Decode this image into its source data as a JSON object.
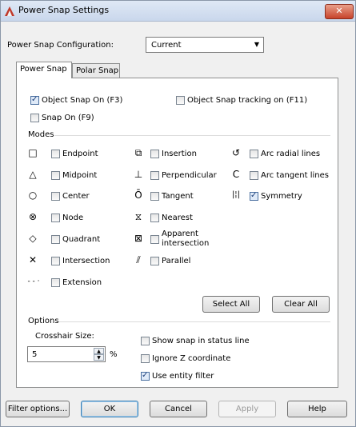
{
  "window": {
    "title": "Power Snap Settings",
    "close_glyph": "✕"
  },
  "config": {
    "label": "Power Snap Configuration:",
    "value": "Current",
    "arrow": "▼"
  },
  "tabs": [
    {
      "label": "Power Snap",
      "active": true
    },
    {
      "label": "Polar Snap",
      "active": false
    }
  ],
  "top_options": {
    "object_snap": {
      "label": "Object Snap On (F3)",
      "checked": true
    },
    "object_snap_tracking": {
      "label": "Object Snap tracking on (F11)",
      "checked": false
    },
    "snap": {
      "label": "Snap On (F9)",
      "checked": false
    }
  },
  "modes": {
    "title": "Modes",
    "items": [
      {
        "label": "Endpoint",
        "icon": "endpoint-icon",
        "glyph": "□",
        "checked": false
      },
      {
        "label": "Midpoint",
        "icon": "midpoint-icon",
        "glyph": "△",
        "checked": false
      },
      {
        "label": "Center",
        "icon": "center-icon",
        "glyph": "○",
        "checked": false
      },
      {
        "label": "Node",
        "icon": "node-icon",
        "glyph": "⊗",
        "checked": false
      },
      {
        "label": "Quadrant",
        "icon": "quadrant-icon",
        "glyph": "◇",
        "checked": false
      },
      {
        "label": "Intersection",
        "icon": "intersection-icon",
        "glyph": "✕",
        "checked": false
      },
      {
        "label": "Extension",
        "icon": "extension-icon",
        "glyph": "- - ·",
        "checked": false
      },
      {
        "label": "Insertion",
        "icon": "insertion-icon",
        "glyph": "⧉",
        "checked": false
      },
      {
        "label": "Perpendicular",
        "icon": "perpendicular-icon",
        "glyph": "⊥",
        "checked": false
      },
      {
        "label": "Tangent",
        "icon": "tangent-icon",
        "glyph": "Ō",
        "checked": false
      },
      {
        "label": "Nearest",
        "icon": "nearest-icon",
        "glyph": "⧖",
        "checked": false
      },
      {
        "label": "Apparent intersection",
        "icon": "apparent-intersection-icon",
        "glyph": "⊠",
        "checked": false
      },
      {
        "label": "Parallel",
        "icon": "parallel-icon",
        "glyph": "⫽",
        "checked": false
      },
      {
        "label": "Arc radial lines",
        "icon": "arc-radial-lines-icon",
        "glyph": "↺",
        "checked": false
      },
      {
        "label": "Arc tangent lines",
        "icon": "arc-tangent-lines-icon",
        "glyph": "C",
        "checked": false
      },
      {
        "label": "Symmetry",
        "icon": "symmetry-icon",
        "glyph": "|¦|",
        "checked": true
      }
    ],
    "select_all": "Select All",
    "clear_all": "Clear All"
  },
  "options": {
    "title": "Options",
    "crosshair_label": "Crosshair Size:",
    "crosshair_value": "5",
    "crosshair_unit": "%",
    "show_snap_status": {
      "label": "Show snap in status line",
      "checked": false
    },
    "ignore_z": {
      "label": "Ignore Z coordinate",
      "checked": false
    },
    "use_entity_filter": {
      "label": "Use entity filter",
      "checked": true
    }
  },
  "buttons": {
    "filter_options": "Filter options...",
    "ok": "OK",
    "cancel": "Cancel",
    "apply": "Apply",
    "help": "Help"
  },
  "colors": {
    "title_gradient_top": "#dfe8f5",
    "close_red": "#c7432b",
    "check_blue": "#1c3d78"
  }
}
